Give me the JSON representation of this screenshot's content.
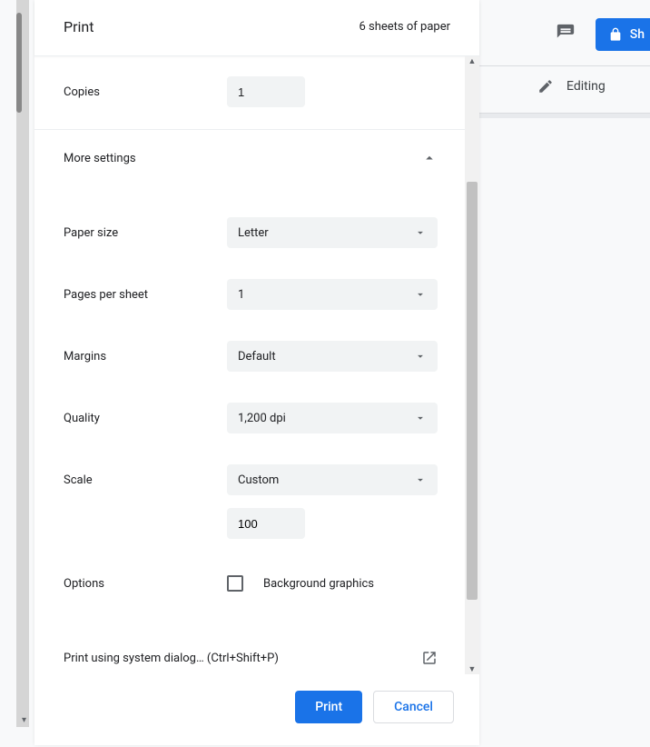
{
  "background": {
    "editing_label": "Editing",
    "share_label": "Sh"
  },
  "dialog": {
    "title": "Print",
    "sheets": "6 sheets of paper",
    "copies_label": "Copies",
    "copies_value": "1",
    "more_settings_label": "More settings",
    "paper_size": {
      "label": "Paper size",
      "value": "Letter"
    },
    "pages_per_sheet": {
      "label": "Pages per sheet",
      "value": "1"
    },
    "margins": {
      "label": "Margins",
      "value": "Default"
    },
    "quality": {
      "label": "Quality",
      "value": "1,200 dpi"
    },
    "scale": {
      "label": "Scale",
      "value": "Custom",
      "custom_value": "100"
    },
    "options": {
      "label": "Options",
      "background_graphics": "Background graphics"
    },
    "system_dialog": "Print using system dialog… (Ctrl+Shift+P)",
    "print_button": "Print",
    "cancel_button": "Cancel"
  }
}
